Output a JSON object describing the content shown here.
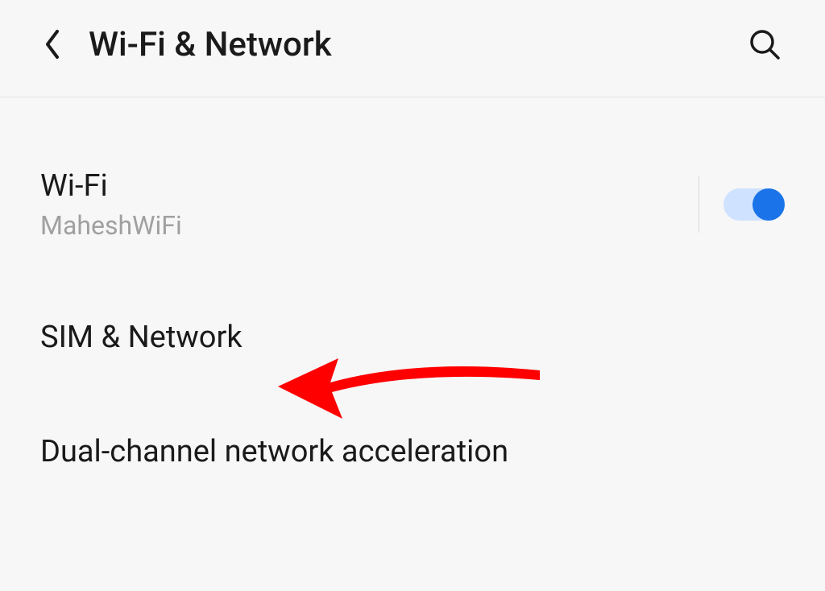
{
  "header": {
    "title": "Wi-Fi & Network"
  },
  "rows": {
    "wifi": {
      "title": "Wi-Fi",
      "subtitle": "MaheshWiFi",
      "toggle": true
    },
    "sim": {
      "title": "SIM & Network"
    },
    "dual": {
      "title": "Dual-channel network acceleration"
    }
  }
}
